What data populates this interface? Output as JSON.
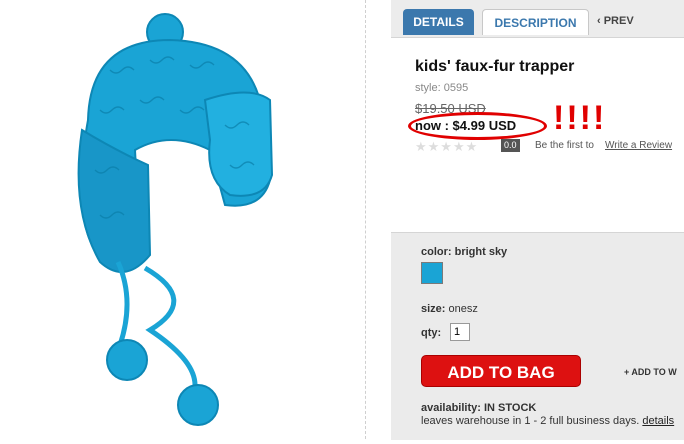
{
  "tabs": {
    "details": "DETAILS",
    "description": "DESCRIPTION",
    "prev": "‹ PREV"
  },
  "product": {
    "title": "kids' faux-fur trapper",
    "style": "style: 0595",
    "original_price": "$19.50 USD",
    "now_price": "now : $4.99 USD",
    "annotation": "!!!!",
    "stars": "★★★★★",
    "rating": "0.0",
    "review_prompt": "Be the first to",
    "review_link": "Write a Review"
  },
  "options": {
    "color_label": "color: bright sky",
    "size_label": "size:",
    "size_value": "onesz",
    "qty_label": "qty:",
    "qty_value": "1",
    "add_to_bag": "ADD TO BAG",
    "add_to_wishlist": "+ ADD TO W",
    "availability_label": "availability:",
    "availability_value": "IN STOCK",
    "leaves": "leaves warehouse in 1 - 2 full business days.",
    "details_link": "details"
  },
  "colors": {
    "accent": "#3b78ad",
    "hat": "#1aa4d5",
    "annotation": "#e00000",
    "cta": "#dd1111"
  }
}
